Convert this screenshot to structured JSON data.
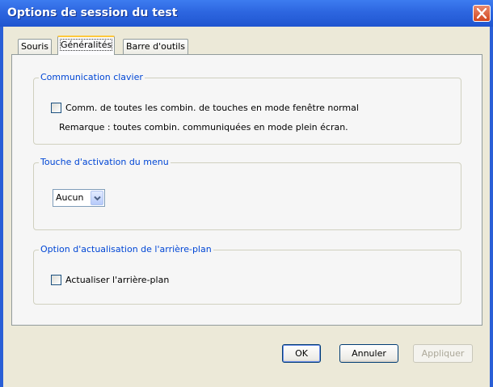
{
  "window": {
    "title": "Options de session du test"
  },
  "tabs": [
    {
      "label": "Souris",
      "active": false
    },
    {
      "label": "Généralités",
      "active": true
    },
    {
      "label": "Barre d'outils",
      "active": false
    }
  ],
  "groups": {
    "keyboard": {
      "legend": "Communication clavier",
      "checkbox_label": "Comm. de toutes les combin. de touches en mode fenêtre normal",
      "checked": false,
      "note": "Remarque : toutes combin. communiquées en mode plein écran."
    },
    "menu_key": {
      "legend": "Touche d'activation du menu",
      "selected": "Aucun"
    },
    "background": {
      "legend": "Option d'actualisation de l'arrière-plan",
      "checkbox_label": "Actualiser l'arrière-plan",
      "checked": false
    }
  },
  "buttons": {
    "ok": "OK",
    "cancel": "Annuler",
    "apply": "Appliquer"
  },
  "icons": {
    "close": "close-icon",
    "dropdown": "chevron-down-icon"
  },
  "colors": {
    "titlebar": "#2d66e0",
    "legend_text": "#0046d5",
    "close_button": "#d2471f",
    "active_tab_highlight": "#ffc83c"
  }
}
